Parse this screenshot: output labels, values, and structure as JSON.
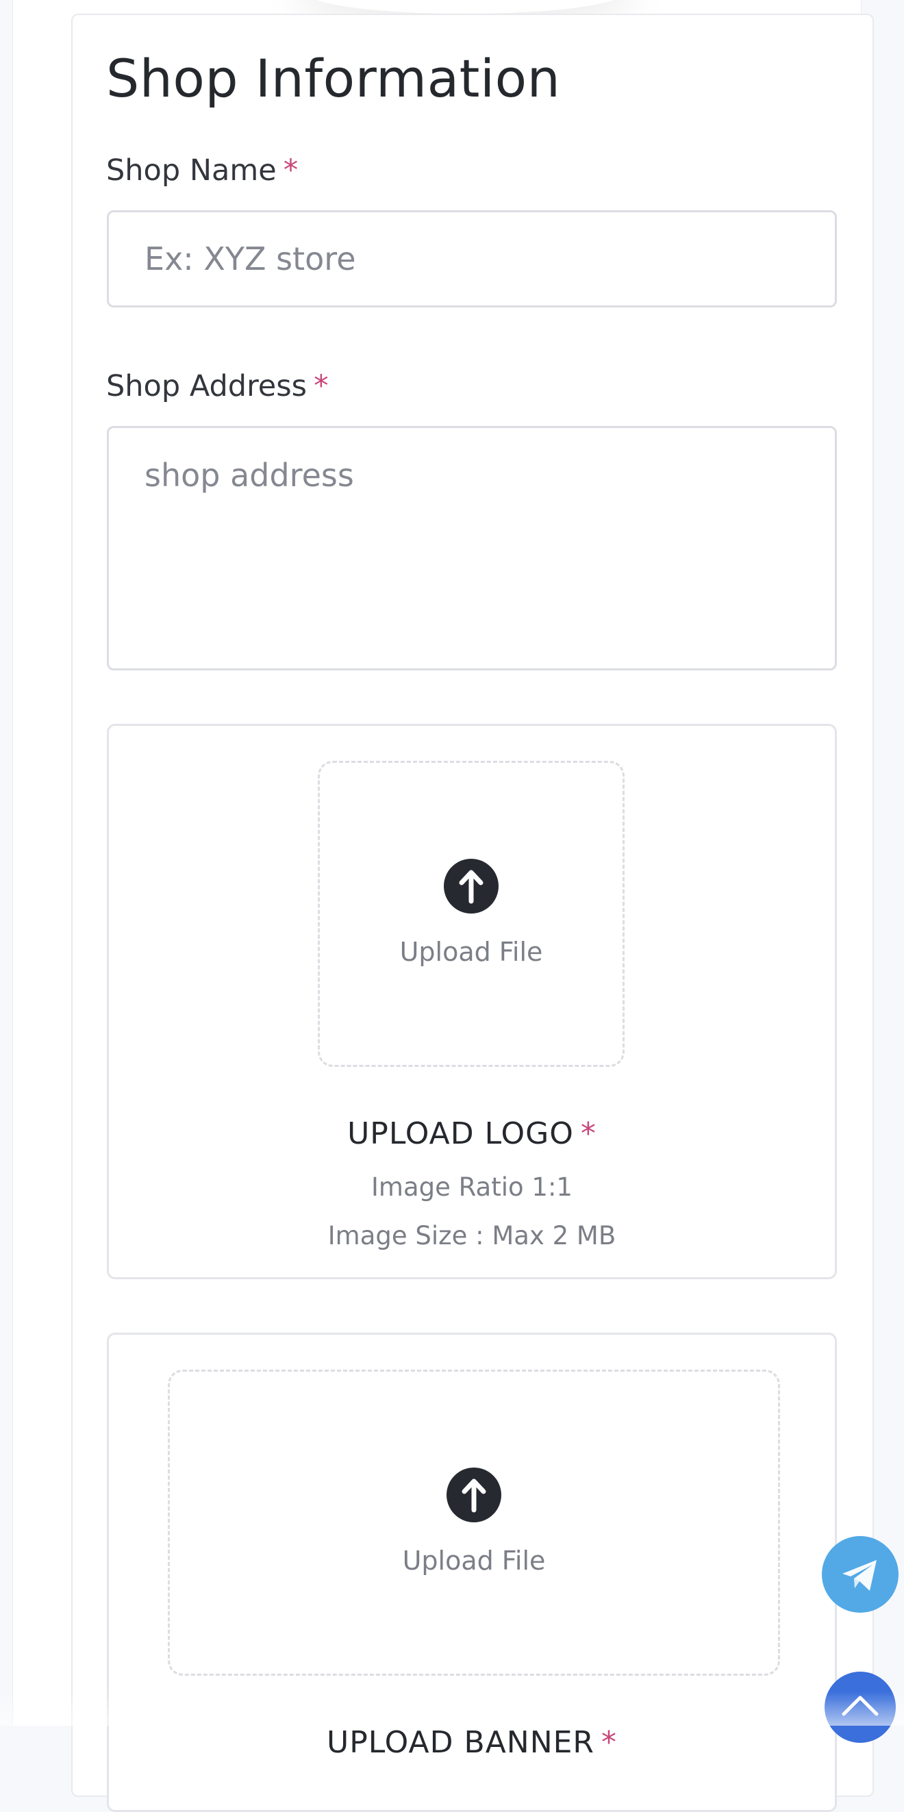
{
  "section": {
    "title": "Shop Information"
  },
  "fields": {
    "shop_name": {
      "label": "Shop Name",
      "required_mark": "*",
      "placeholder": "Ex: XYZ store",
      "value": ""
    },
    "shop_address": {
      "label": "Shop Address",
      "required_mark": "*",
      "placeholder": "shop address",
      "value": ""
    }
  },
  "logo_upload": {
    "button_text": "Upload File",
    "title": "UPLOAD LOGO",
    "required_mark": "*",
    "ratio": "Image Ratio 1:1",
    "size": "Image Size : Max 2 MB"
  },
  "banner_upload": {
    "button_text": "Upload File",
    "title": "UPLOAD BANNER",
    "required_mark": "*"
  },
  "floating": {
    "telegram_icon": "telegram-icon",
    "scroll_top_icon": "chevron-up-icon"
  },
  "colors": {
    "required": "#c8467a",
    "telegram": "#52a9e6",
    "scroll_top": "#3a6fdc",
    "icon_dark": "#262a30"
  }
}
